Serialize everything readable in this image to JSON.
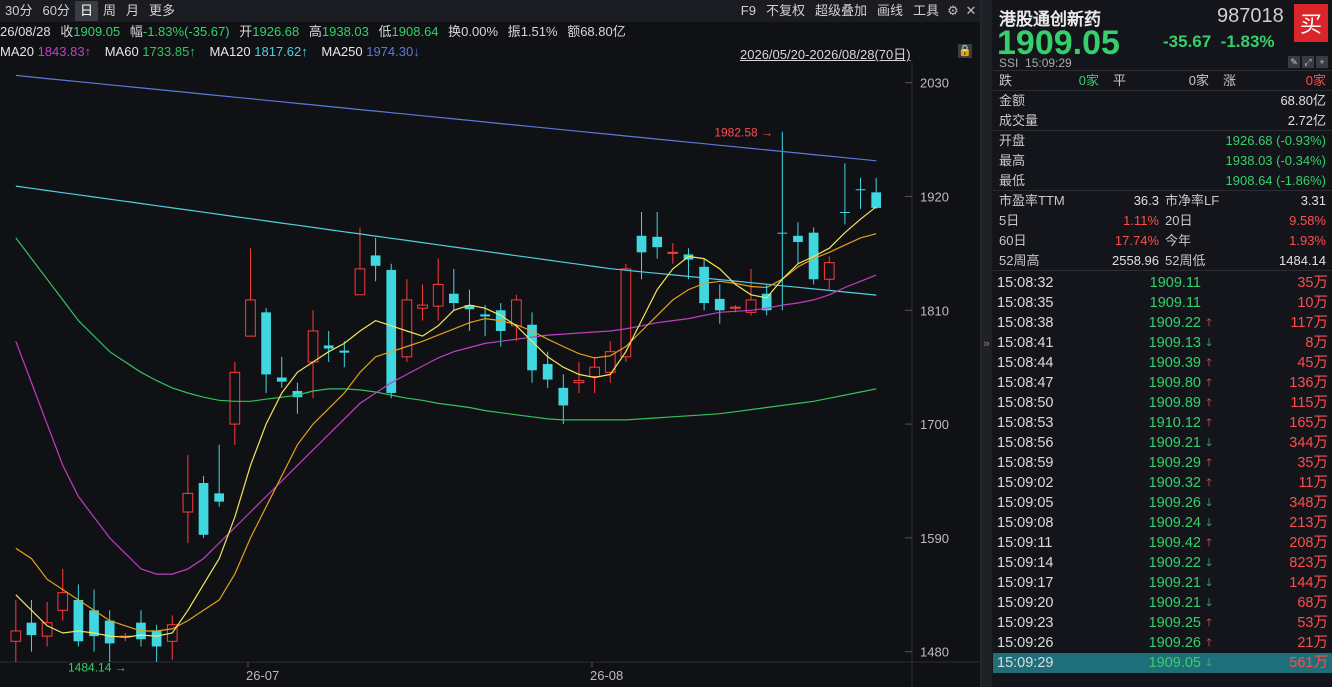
{
  "toolbar": {
    "tabs": [
      "30分",
      "60分",
      "日",
      "周",
      "月",
      "更多"
    ],
    "active_index": 2,
    "f9": "F9",
    "no_adjust": "不复权",
    "overlay": "超级叠加",
    "draw": "画线",
    "tools": "工具"
  },
  "info": {
    "date": "26/08/28",
    "close_label": "收",
    "close": "1909.05",
    "amp_label": "幅",
    "amp": "-1.83%(-35.67)",
    "open_label": "开",
    "open": "1926.68",
    "high_label": "高",
    "high": "1938.03",
    "low_label": "低",
    "low": "1908.64",
    "turnover_label": "换",
    "turnover": "0.00%",
    "swing_label": "振",
    "swing": "1.51%",
    "amount_label": "额",
    "amount": "68.80亿"
  },
  "ma": {
    "ma20": "MA20",
    "ma20_v": "1843.83↑",
    "ma60": "MA60",
    "ma60_v": "1733.85↑",
    "ma120": "MA120",
    "ma120_v": "1817.62↑",
    "ma250": "MA250",
    "ma250_v": "1974.30↓",
    "ma20_color": "#c040c0",
    "ma60_color": "#35c060",
    "ma120_color": "#4fd0e0",
    "ma250_color": "#5a7ad8"
  },
  "range": "2026/05/20-2026/08/28(70日)",
  "chart_data": {
    "type": "candlestick",
    "yticks": [
      "2030",
      "1920",
      "1810",
      "1700",
      "1590",
      "1480"
    ],
    "xticks": [
      "26-07",
      "26-08"
    ],
    "annot_high": "1982.58",
    "annot_low": "1484.14",
    "ymin": 1470,
    "ymax": 2050
  },
  "stock": {
    "name": "港股通创新药",
    "code": "987018",
    "buy": "买",
    "price": "1909.05",
    "change": "-35.67",
    "pct": "-1.83%",
    "ssi": "SSI",
    "time": "15:09:29"
  },
  "stats": {
    "down": "跌",
    "down_v": "0家",
    "flat": "平",
    "flat_v": "0家",
    "up": "涨",
    "up_v": "0家",
    "amount_label": "金额",
    "amount": "68.80亿",
    "vol_label": "成交量",
    "vol": "2.72亿",
    "open_label": "开盘",
    "open": "1926.68 (-0.93%)",
    "high_label": "最高",
    "high": "1938.03 (-0.34%)",
    "low_label": "最低",
    "low": "1908.64 (-1.86%)",
    "pe_label": "市盈率TTM",
    "pe": "36.3",
    "pb_label": "市净率LF",
    "pb": "3.31",
    "d5_label": "5日",
    "d5": "1.11%",
    "d20_label": "20日",
    "d20": "9.58%",
    "d60_label": "60日",
    "d60": "17.74%",
    "ytd_label": "今年",
    "ytd": "1.93%",
    "w52h_label": "52周高",
    "w52h": "2558.96",
    "w52l_label": "52周低",
    "w52l": "1484.14"
  },
  "ticks": [
    {
      "t": "15:08:32",
      "p": "1909.11",
      "a": "",
      "v": "35万"
    },
    {
      "t": "15:08:35",
      "p": "1909.11",
      "a": "",
      "v": "10万"
    },
    {
      "t": "15:08:38",
      "p": "1909.22",
      "a": "up",
      "v": "117万"
    },
    {
      "t": "15:08:41",
      "p": "1909.13",
      "a": "down",
      "v": "8万"
    },
    {
      "t": "15:08:44",
      "p": "1909.39",
      "a": "up",
      "v": "45万"
    },
    {
      "t": "15:08:47",
      "p": "1909.80",
      "a": "up",
      "v": "136万"
    },
    {
      "t": "15:08:50",
      "p": "1909.89",
      "a": "up",
      "v": "115万"
    },
    {
      "t": "15:08:53",
      "p": "1910.12",
      "a": "up",
      "v": "165万"
    },
    {
      "t": "15:08:56",
      "p": "1909.21",
      "a": "down",
      "v": "344万"
    },
    {
      "t": "15:08:59",
      "p": "1909.29",
      "a": "up",
      "v": "35万"
    },
    {
      "t": "15:09:02",
      "p": "1909.32",
      "a": "up",
      "v": "11万"
    },
    {
      "t": "15:09:05",
      "p": "1909.26",
      "a": "down",
      "v": "348万"
    },
    {
      "t": "15:09:08",
      "p": "1909.24",
      "a": "down",
      "v": "213万"
    },
    {
      "t": "15:09:11",
      "p": "1909.42",
      "a": "up",
      "v": "208万"
    },
    {
      "t": "15:09:14",
      "p": "1909.22",
      "a": "down",
      "v": "823万"
    },
    {
      "t": "15:09:17",
      "p": "1909.21",
      "a": "down",
      "v": "144万"
    },
    {
      "t": "15:09:20",
      "p": "1909.21",
      "a": "down",
      "v": "68万"
    },
    {
      "t": "15:09:23",
      "p": "1909.25",
      "a": "up",
      "v": "53万"
    },
    {
      "t": "15:09:26",
      "p": "1909.26",
      "a": "up",
      "v": "21万"
    },
    {
      "t": "15:09:29",
      "p": "1909.05",
      "a": "down",
      "v": "561万"
    }
  ]
}
